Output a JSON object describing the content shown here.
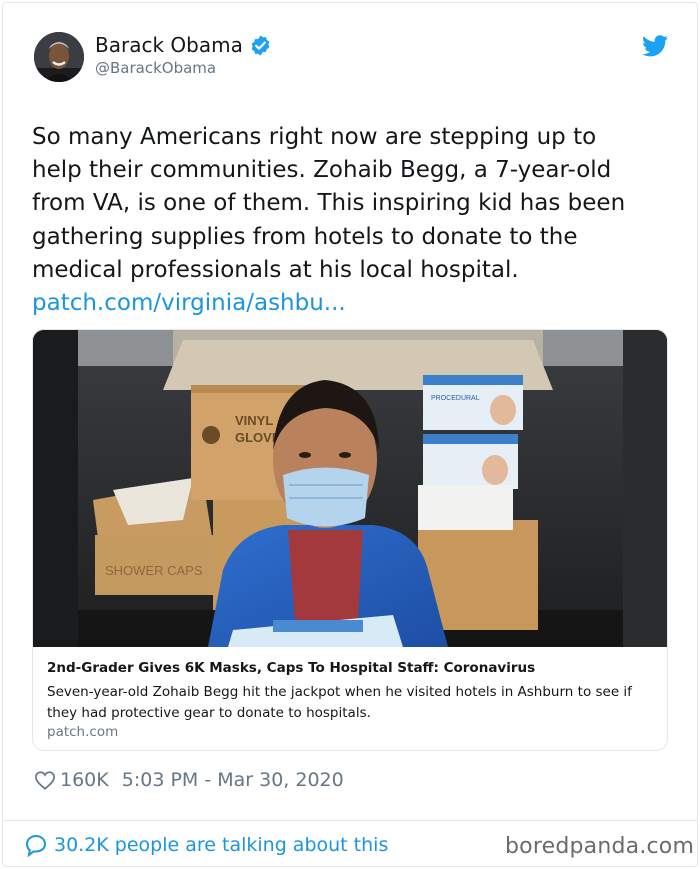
{
  "user": {
    "name": "Barack Obama",
    "handle": "@BarackObama"
  },
  "icons": {
    "verified": "verified-badge-icon",
    "platform": "twitter-bird-icon",
    "like": "heart-icon",
    "conversation": "speech-bubble-icon"
  },
  "tweet": {
    "text_lines": [
      "So many Americans right now are stepping up to",
      "help their communities. Zohaib Begg, a 7-year-old",
      "from VA, is one of them. This inspiring kid has been",
      "gathering supplies from hotels to donate to the",
      "medical professionals at his local hospital."
    ],
    "link": "patch.com/virginia/ashbu..."
  },
  "card": {
    "image_text": {
      "box_vinyl_1": "VINYL",
      "box_vinyl_2": "GLOVES",
      "box_shower": "SHOWER CAPS",
      "mask_box": "PROCEDURAL"
    },
    "title": "2nd-Grader Gives 6K Masks, Caps To Hospital Staff: Coronavirus",
    "description_lines": [
      "Seven-year-old Zohaib Begg hit the jackpot when he visited hotels in Ashburn to see if",
      "they had protective gear to donate to hospitals."
    ],
    "domain": "patch.com"
  },
  "meta": {
    "likes": "160K",
    "timestamp": "5:03 PM - Mar 30, 2020"
  },
  "footer": {
    "conversation": "30.2K people are talking about this",
    "watermark": "boredpanda.com"
  },
  "colors": {
    "link_blue": "#1b95e0",
    "muted_gray": "#657786",
    "border": "#e1e8ed",
    "verified_blue": "#1da1f2"
  }
}
